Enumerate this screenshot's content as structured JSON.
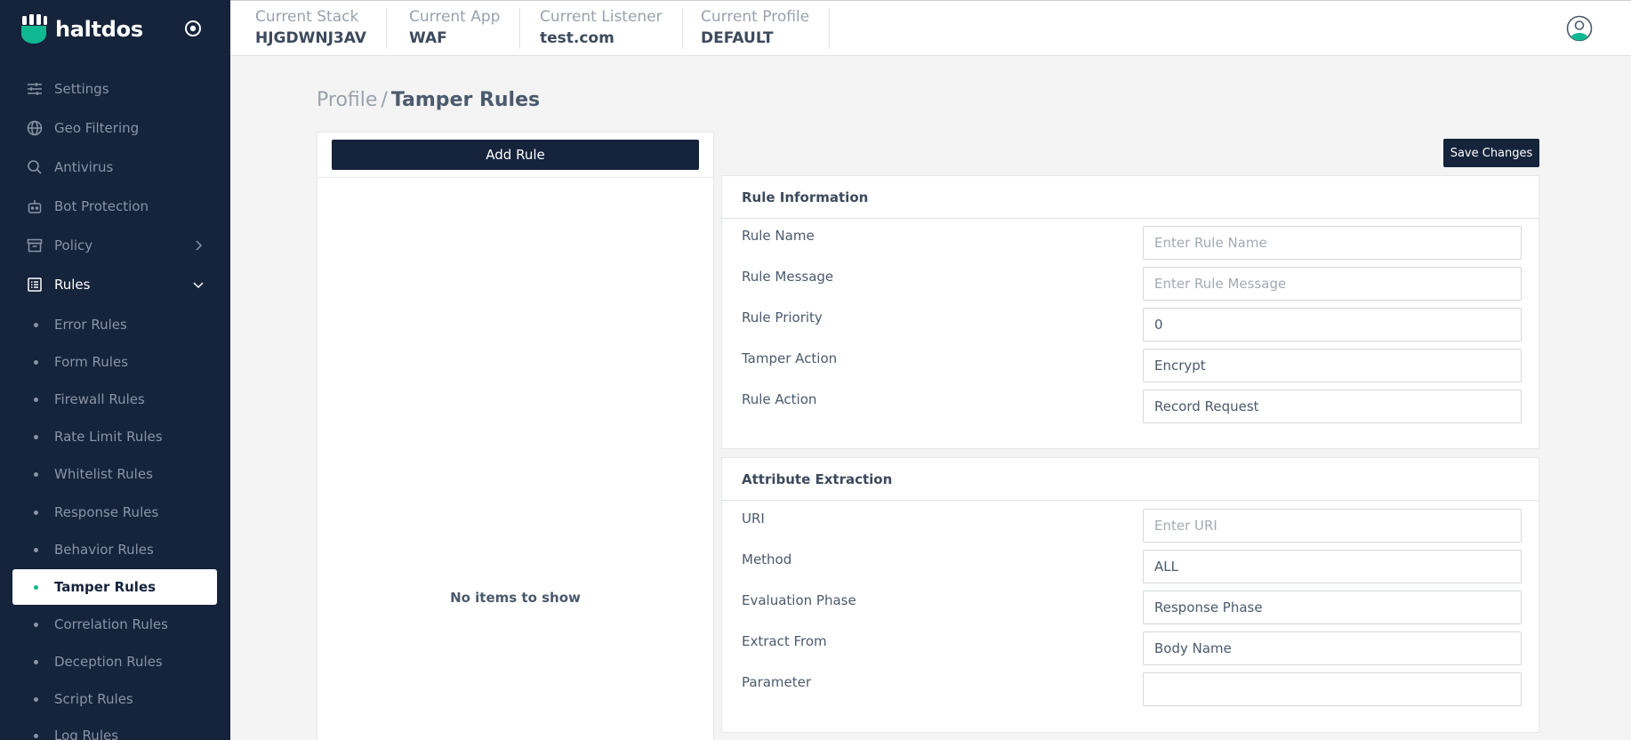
{
  "brand": {
    "name": "haltdos"
  },
  "sidebar": {
    "items": [
      {
        "label": "Settings",
        "icon": "sliders-icon"
      },
      {
        "label": "Geo Filtering",
        "icon": "globe-icon"
      },
      {
        "label": "Antivirus",
        "icon": "search-icon"
      },
      {
        "label": "Bot Protection",
        "icon": "robot-icon"
      },
      {
        "label": "Policy",
        "icon": "archive-icon"
      },
      {
        "label": "Rules",
        "icon": "list-icon"
      }
    ],
    "rules_subitems": [
      "Error Rules",
      "Form Rules",
      "Firewall Rules",
      "Rate Limit Rules",
      "Whitelist Rules",
      "Response Rules",
      "Behavior Rules",
      "Tamper Rules",
      "Correlation Rules",
      "Deception Rules",
      "Script Rules",
      "Log Rules"
    ],
    "active_subitem": "Tamper Rules"
  },
  "header": {
    "stack_label": "Current Stack",
    "stack_value": "HJGDWNJ3AV",
    "app_label": "Current App",
    "app_value": "WAF",
    "listener_label": "Current Listener",
    "listener_value": "test.com",
    "profile_label": "Current Profile",
    "profile_value": "DEFAULT"
  },
  "breadcrumb": {
    "root": "Profile",
    "separator": "/",
    "current": "Tamper Rules"
  },
  "rules_list": {
    "add_label": "Add Rule",
    "empty_message": "No items to show"
  },
  "actions": {
    "save_label": "Save Changes"
  },
  "rule_information": {
    "title": "Rule Information",
    "fields": [
      {
        "label": "Rule Name",
        "value": "",
        "placeholder": "Enter Rule Name"
      },
      {
        "label": "Rule Message",
        "value": "",
        "placeholder": "Enter Rule Message"
      },
      {
        "label": "Rule Priority",
        "value": "0",
        "placeholder": ""
      },
      {
        "label": "Tamper Action",
        "value": "Encrypt",
        "placeholder": ""
      },
      {
        "label": "Rule Action",
        "value": "Record Request",
        "placeholder": ""
      }
    ]
  },
  "attribute_extraction": {
    "title": "Attribute Extraction",
    "fields": [
      {
        "label": "URI",
        "value": "",
        "placeholder": "Enter URI"
      },
      {
        "label": "Method",
        "value": "ALL",
        "placeholder": ""
      },
      {
        "label": "Evaluation Phase",
        "value": "Response Phase",
        "placeholder": ""
      },
      {
        "label": "Extract From",
        "value": "Body Name",
        "placeholder": ""
      },
      {
        "label": "Parameter",
        "value": "",
        "placeholder": ""
      }
    ]
  },
  "colors": {
    "sidebar_bg": "#15233b",
    "accent": "#0fb890",
    "page_bg": "#f3f4f3"
  }
}
